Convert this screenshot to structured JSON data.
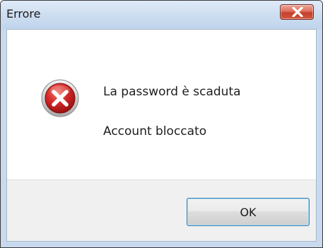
{
  "window": {
    "title": "Errore",
    "close_icon": "close-x-icon"
  },
  "message": {
    "icon": "error-icon",
    "line1": "La password è scaduta",
    "line2": "Account bloccato"
  },
  "buttons": {
    "ok_label": "OK"
  },
  "colors": {
    "close_button": "#c4412c",
    "error_red": "#d42a2a",
    "ok_border": "#3c7fb1",
    "button_bar": "#f0f0f0"
  }
}
